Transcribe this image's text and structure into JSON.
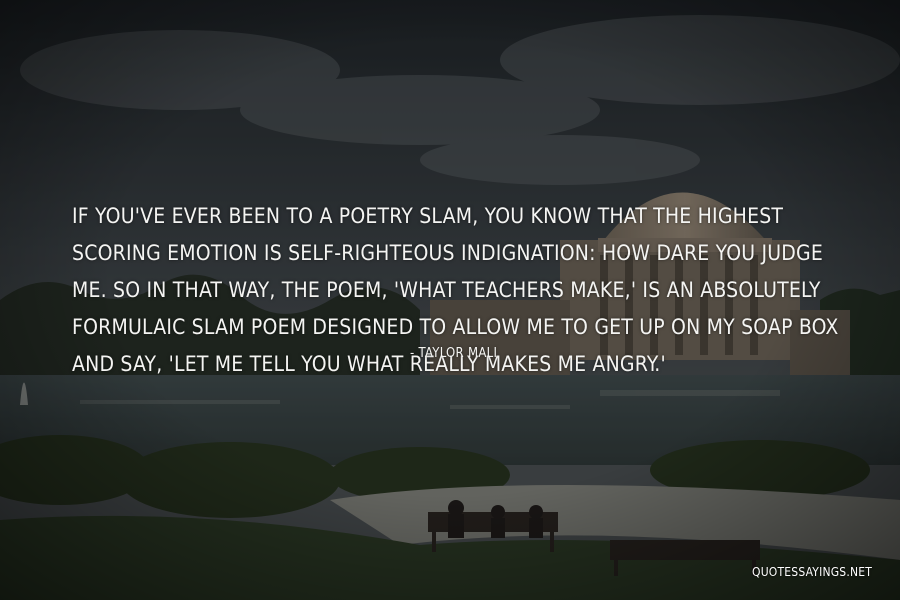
{
  "quote": {
    "text": "If you've ever been to a poetry slam, you know that the highest scoring emotion is self-righteous indignation: How dare you judge me. So in that way, the poem, 'What Teachers Make,' is an absolutely formulaic slam poem designed to allow me to get up on my soap box and say, 'Let me tell you what really makes me angry.'",
    "author": "- Taylor Mali"
  },
  "watermark": {
    "site": "QUOTESSAYINGS.NET"
  },
  "colors": {
    "text": "#f4f4f2",
    "sky_dark": "#1f2428",
    "sky_light": "#5a6064",
    "water": "#3b4649",
    "grass": "#2b3a28",
    "dome": "#8a7a6a"
  }
}
